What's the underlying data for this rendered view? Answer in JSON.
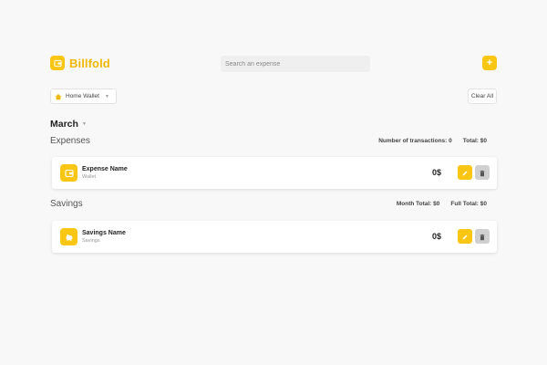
{
  "app": {
    "name": "Billfold"
  },
  "search": {
    "placeholder": "Search an expense"
  },
  "header": {
    "add_label": "+"
  },
  "wallet": {
    "selected": "Home Wallet"
  },
  "actions": {
    "clear_all": "Clear All"
  },
  "month": {
    "name": "March"
  },
  "expenses": {
    "title": "Expenses",
    "transactions_label": "Number of transactions: 0",
    "total_label": "Total: $0",
    "item": {
      "name": "Expense Name",
      "category": "Wallet",
      "amount": "0$"
    }
  },
  "savings": {
    "title": "Savings",
    "month_total_label": "Month Total: $0",
    "full_total_label": "Full Total: $0",
    "item": {
      "name": "Savings Name",
      "category": "Savings",
      "amount": "0$"
    }
  },
  "colors": {
    "accent": "#f9c614",
    "brand_text": "#f2b705",
    "delete": "#d0d0d0"
  },
  "icons": [
    "wallet-icon",
    "plus-icon",
    "home-icon",
    "chevron-down-icon",
    "piggy-bank-icon",
    "pencil-icon",
    "trash-icon"
  ]
}
